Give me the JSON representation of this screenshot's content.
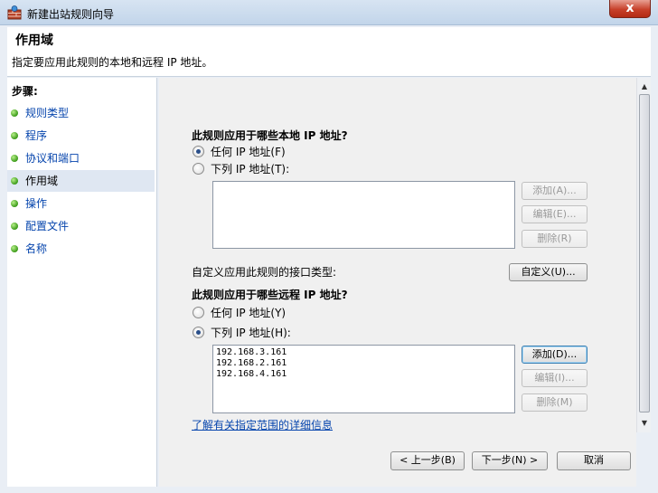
{
  "window": {
    "title": "新建出站规则向导",
    "close_glyph": "x"
  },
  "header": {
    "title": "作用域",
    "subtitle": "指定要应用此规则的本地和远程 IP 地址。"
  },
  "sidebar": {
    "heading": "步骤:",
    "items": [
      {
        "label": "规则类型"
      },
      {
        "label": "程序"
      },
      {
        "label": "协议和端口"
      },
      {
        "label": "作用域"
      },
      {
        "label": "操作"
      },
      {
        "label": "配置文件"
      },
      {
        "label": "名称"
      }
    ],
    "active_index": 3
  },
  "local": {
    "heading": "此规则应用于哪些本地 IP 地址?",
    "any_label": "任何 IP 地址(F)",
    "list_label": "下列 IP 地址(T):",
    "selected": "any",
    "addresses": [],
    "add_label": "添加(A)...",
    "edit_label": "编辑(E)...",
    "remove_label": "删除(R)"
  },
  "interface": {
    "label": "自定义应用此规则的接口类型:",
    "button_label": "自定义(U)..."
  },
  "remote": {
    "heading": "此规则应用于哪些远程 IP 地址?",
    "any_label": "任何 IP 地址(Y)",
    "list_label": "下列 IP 地址(H):",
    "selected": "list",
    "addresses": [
      "192.168.3.161",
      "192.168.2.161",
      "192.168.4.161"
    ],
    "add_label": "添加(D)...",
    "edit_label": "编辑(I)...",
    "remove_label": "删除(M)"
  },
  "help_link": "了解有关指定范围的详细信息",
  "footer": {
    "back_label": "< 上一步(B)",
    "next_label": "下一步(N) >",
    "cancel_label": "取消"
  },
  "colors": {
    "link": "#0645ad",
    "close_button": "#c7402a",
    "step_dot": "#3a9a18"
  }
}
